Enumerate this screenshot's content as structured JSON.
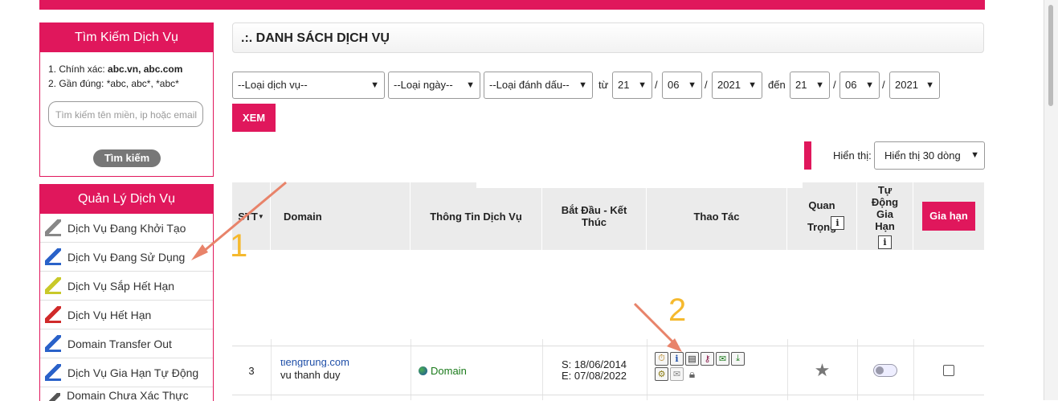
{
  "search_panel": {
    "title": "Tìm Kiếm Dịch Vụ",
    "hint1_prefix": "1. Chính xác: ",
    "hint1_value": "abc.vn, abc.com",
    "hint2_prefix": "2. Gần đúng: ",
    "hint2_value": "*abc, abc*, *abc*",
    "input_placeholder": "Tìm kiếm tên miền, ip hoặc email",
    "button_label": "Tìm kiếm"
  },
  "manage_panel": {
    "title": "Quản Lý Dịch Vụ",
    "items": [
      {
        "label": "Dịch Vụ Đang Khởi Tạo",
        "icon": "service-init-icon",
        "color": "#888888"
      },
      {
        "label": "Dịch Vụ Đang Sử Dụng",
        "icon": "service-active-icon",
        "color": "#2a62c9"
      },
      {
        "label": "Dịch Vụ Sắp Hết Hạn",
        "icon": "service-expiring-icon",
        "color": "#c9c92a"
      },
      {
        "label": "Dịch Vụ Hết Hạn",
        "icon": "service-expired-icon",
        "color": "#d02a2a"
      },
      {
        "label": "Domain Transfer Out",
        "icon": "transfer-out-icon",
        "color": "#2a62c9"
      },
      {
        "label": "Dịch Vụ Gia Hạn Tự Động",
        "icon": "auto-renew-icon",
        "color": "#2a62c9"
      },
      {
        "label": "Domain Chưa Xác Thực Email",
        "icon": "unverified-email-icon",
        "color": "#555555"
      }
    ]
  },
  "page_title": ".:. DANH SÁCH DỊCH VỤ",
  "filters": {
    "service_type": "--Loại dịch vụ--",
    "date_type": "--Loại ngày--",
    "mark_type": "--Loại đánh dấu--",
    "from_label": "từ",
    "to_label": "đến",
    "sep": "/",
    "from_day": "21",
    "from_month": "06",
    "from_year": "2021",
    "to_day": "21",
    "to_month": "06",
    "to_year": "2021",
    "submit_label": "XEM"
  },
  "display": {
    "label": "Hiển thị:",
    "value": "Hiển thị 30 dòng"
  },
  "table": {
    "headers": {
      "stt": "STT",
      "domain": "Domain",
      "info": "Thông Tin Dịch Vụ",
      "dates": "Bắt Đầu - Kết Thúc",
      "actions": "Thao Tác",
      "important": "Quan Trọng",
      "auto_renew": "Tự Động Gia Hạn",
      "renew_button": "Gia hạn"
    },
    "info_glyph": "i",
    "rows": [
      {
        "stt": "3",
        "domain": "tiengtrung.com",
        "owner": "vu thanh duy",
        "info": "Domain",
        "start": "S: 18/06/2014",
        "end": "E: 07/08/2022"
      }
    ]
  },
  "annotations": {
    "one": "1",
    "two": "2"
  },
  "colors": {
    "accent": "#e0175c",
    "annotation": "#f5b92e",
    "arrow": "#e8836a"
  }
}
